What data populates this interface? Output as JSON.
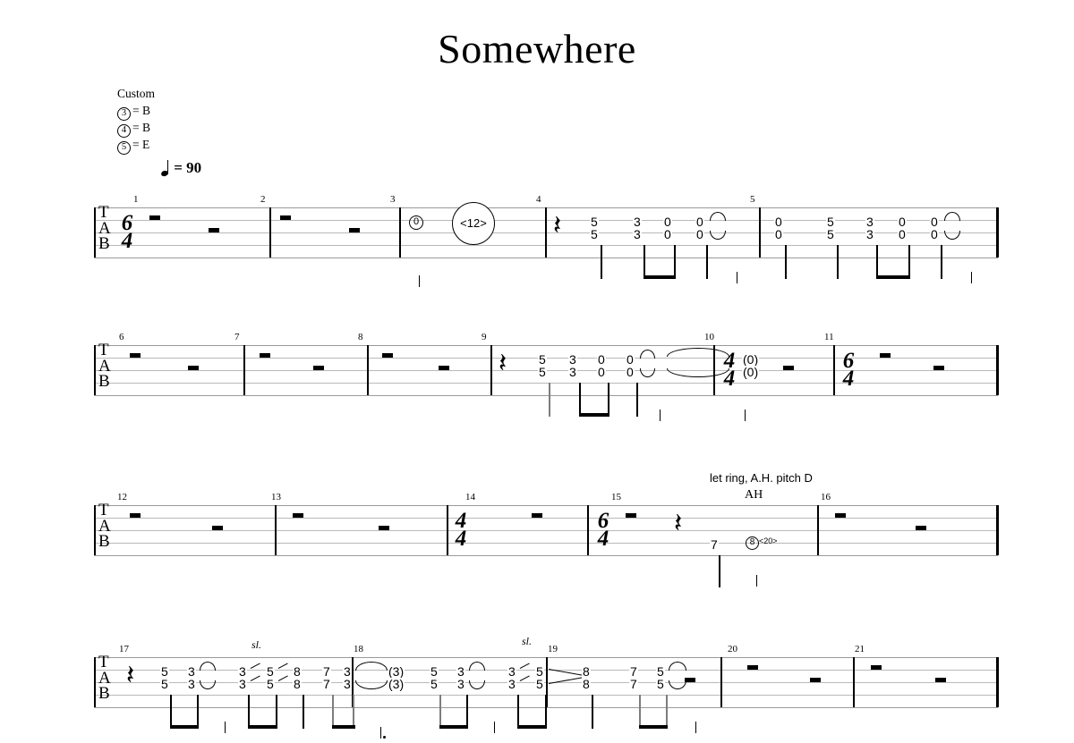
{
  "title": "Somewhere",
  "tuning": {
    "label": "Custom",
    "strings": [
      {
        "num": "3",
        "eq": "= B"
      },
      {
        "num": "4",
        "eq": "= B"
      },
      {
        "num": "5",
        "eq": "= E"
      }
    ]
  },
  "tempo": {
    "value": "= 90"
  },
  "staff": {
    "letters": [
      "T",
      "A",
      "B"
    ]
  },
  "systems": [
    {
      "id": "system-1",
      "measures": [
        "1",
        "2",
        "3",
        "4",
        "5"
      ],
      "timesig": {
        "top": "6",
        "bottom": "4"
      }
    },
    {
      "id": "system-2",
      "measures": [
        "6",
        "7",
        "8",
        "9",
        "10",
        "11"
      ],
      "timesig_10": {
        "top": "4",
        "bottom": "4"
      },
      "timesig_11": {
        "top": "6",
        "bottom": "4"
      }
    },
    {
      "id": "system-3",
      "measures": [
        "12",
        "13",
        "14",
        "15",
        "16"
      ],
      "timesig_14": {
        "top": "4",
        "bottom": "4"
      },
      "timesig_15": {
        "top": "6",
        "bottom": "4"
      }
    },
    {
      "id": "system-4",
      "measures": [
        "17",
        "18",
        "19",
        "20",
        "21"
      ]
    }
  ],
  "marks": {
    "harmonic_0": "0",
    "harmonic_12": "<12>",
    "let_ring": "let ring, A.H. pitch D",
    "ah": "AH",
    "harm8": "8",
    "harm20": "<20>",
    "slide_1": "sl.",
    "slide_2": "sl."
  },
  "notes": {
    "m4": [
      {
        "hi": "5",
        "lo": "5"
      },
      {
        "hi": "3",
        "lo": "3"
      },
      {
        "hi": "0",
        "lo": "0"
      },
      {
        "hi": "0",
        "lo": "0"
      }
    ],
    "m5": [
      {
        "hi": "0",
        "lo": "0"
      },
      {
        "hi": "5",
        "lo": "5"
      },
      {
        "hi": "3",
        "lo": "3"
      },
      {
        "hi": "0",
        "lo": "0"
      },
      {
        "hi": "0",
        "lo": "0"
      }
    ],
    "m9": [
      {
        "hi": "5",
        "lo": "5"
      },
      {
        "hi": "3",
        "lo": "3"
      },
      {
        "hi": "0",
        "lo": "0"
      },
      {
        "hi": "0",
        "lo": "0"
      }
    ],
    "m10": [
      {
        "hi": "(0)",
        "lo": "(0)"
      }
    ],
    "m15": [
      {
        "hi": "7"
      }
    ],
    "m17": [
      {
        "hi": "5",
        "lo": "5"
      },
      {
        "hi": "3",
        "lo": "3"
      },
      {
        "hi": "3",
        "lo": "3"
      },
      {
        "hi": "5",
        "lo": "5"
      },
      {
        "hi": "8",
        "lo": "8"
      },
      {
        "hi": "7",
        "lo": "7"
      },
      {
        "hi": "3",
        "lo": "3"
      }
    ],
    "m18": [
      {
        "hi": "(3)",
        "lo": "(3)"
      },
      {
        "hi": "5",
        "lo": "5"
      },
      {
        "hi": "3",
        "lo": "3"
      },
      {
        "hi": "3",
        "lo": "3"
      },
      {
        "hi": "5",
        "lo": "5"
      }
    ],
    "m19": [
      {
        "hi": "8",
        "lo": "8"
      },
      {
        "hi": "7",
        "lo": "7"
      },
      {
        "hi": "5",
        "lo": "5"
      }
    ]
  }
}
